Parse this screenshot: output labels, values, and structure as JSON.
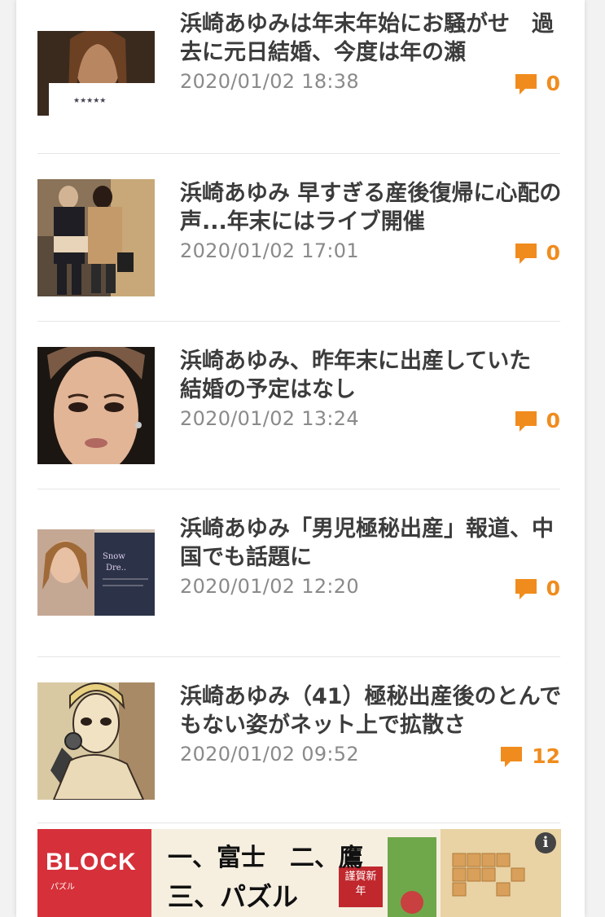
{
  "accent_color": "#f08c1e",
  "articles": [
    {
      "title": "浜崎あゆみは年末年始にお騒がせ　過去に元日結婚、今度は年の瀬",
      "date": "2020/01/02 18:38",
      "comments": "0",
      "thumbnail": "ayumi-portrait-dark"
    },
    {
      "title": "浜崎あゆみ 早すぎる産後復帰に心配の声...年末にはライブ開催",
      "date": "2020/01/02 17:01",
      "comments": "0",
      "thumbnail": "couple-walking-photo"
    },
    {
      "title": "浜崎あゆみ、昨年末に出産していた　結婚の予定はなし",
      "date": "2020/01/02 13:24",
      "comments": "0",
      "thumbnail": "ayumi-face-closeup"
    },
    {
      "title": "浜崎あゆみ「男児極秘出産」報道、中国でも話題に",
      "date": "2020/01/02 12:20",
      "comments": "0",
      "thumbnail": "album-booklet-photo"
    },
    {
      "title": "浜崎あゆみ（41）極秘出産後のとんでもない姿がネット上で拡散さ",
      "date": "2020/01/02 09:52",
      "comments": "12",
      "thumbnail": "singer-with-microphone"
    }
  ],
  "ad": {
    "logo": "BLOCK",
    "logo_sub": "パズル",
    "line1": "一、富士　二、鷹",
    "line2": "三、パズル",
    "badge": "謹賀新年",
    "info_label": "i"
  }
}
